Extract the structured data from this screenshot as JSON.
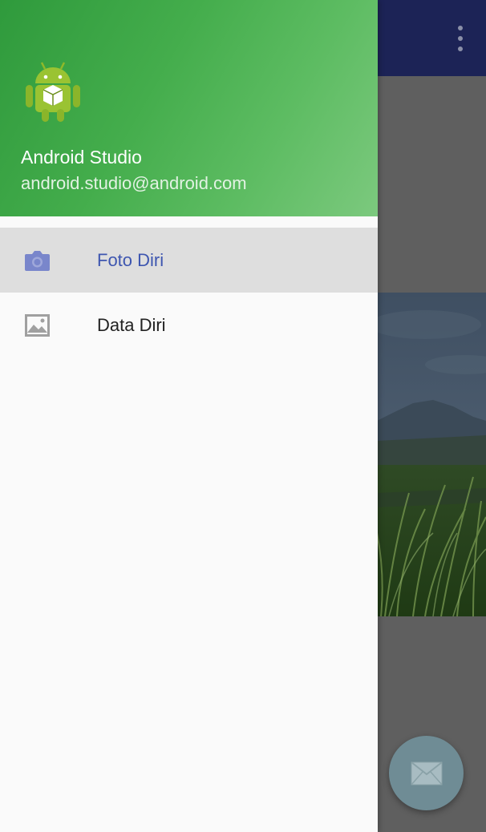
{
  "drawer": {
    "header": {
      "name": "Android Studio",
      "email": "android.studio@android.com",
      "avatar_icon": "android-robot-icon"
    },
    "menu": [
      {
        "label": "Foto Diri",
        "icon": "camera-icon",
        "selected": true
      },
      {
        "label": "Data Diri",
        "icon": "image-icon",
        "selected": false
      }
    ]
  },
  "app": {
    "toolbar": {
      "overflow_icon": "more-vert-icon"
    },
    "fab": {
      "icon": "email-icon"
    }
  },
  "colors": {
    "header_green": "#44ad4c",
    "toolbar": "#1c2356",
    "selected_text": "#3e56b0",
    "fab": "#6f8c95"
  }
}
